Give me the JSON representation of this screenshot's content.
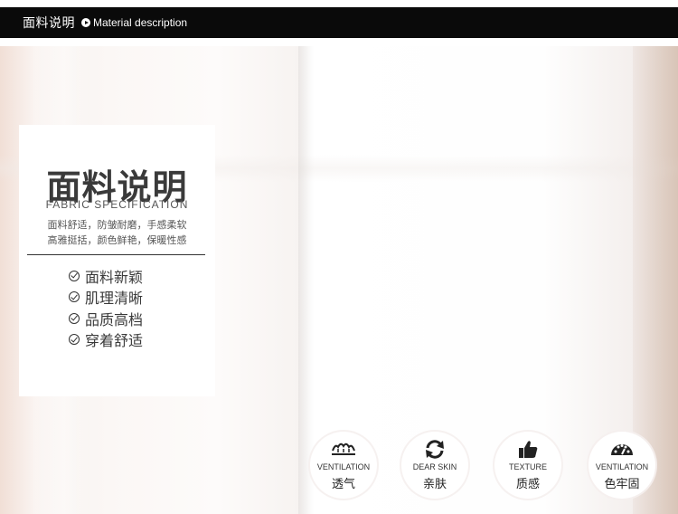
{
  "header": {
    "title": "面料说明",
    "subtitle": "Material description"
  },
  "card": {
    "title": "面料说明",
    "title_en": "FABRIC SPECIFICATION",
    "desc_line1": "面料舒适，防皱耐磨，手感柔软",
    "desc_line2": "高雅挺括，颜色鲜艳，保暖性感",
    "features": [
      "面料新颖",
      "肌理清晰",
      "品质高档",
      "穿着舒适"
    ]
  },
  "badges": [
    {
      "icon": "ventilation-icon",
      "en": "VENTILATION",
      "cn": "透气"
    },
    {
      "icon": "refresh-icon",
      "en": "DEAR SKIN",
      "cn": "亲肤"
    },
    {
      "icon": "thumbs-up-icon",
      "en": "TEXTURE",
      "cn": "质感"
    },
    {
      "icon": "gauge-icon",
      "en": "VENTILATION",
      "cn": "色牢固"
    }
  ]
}
